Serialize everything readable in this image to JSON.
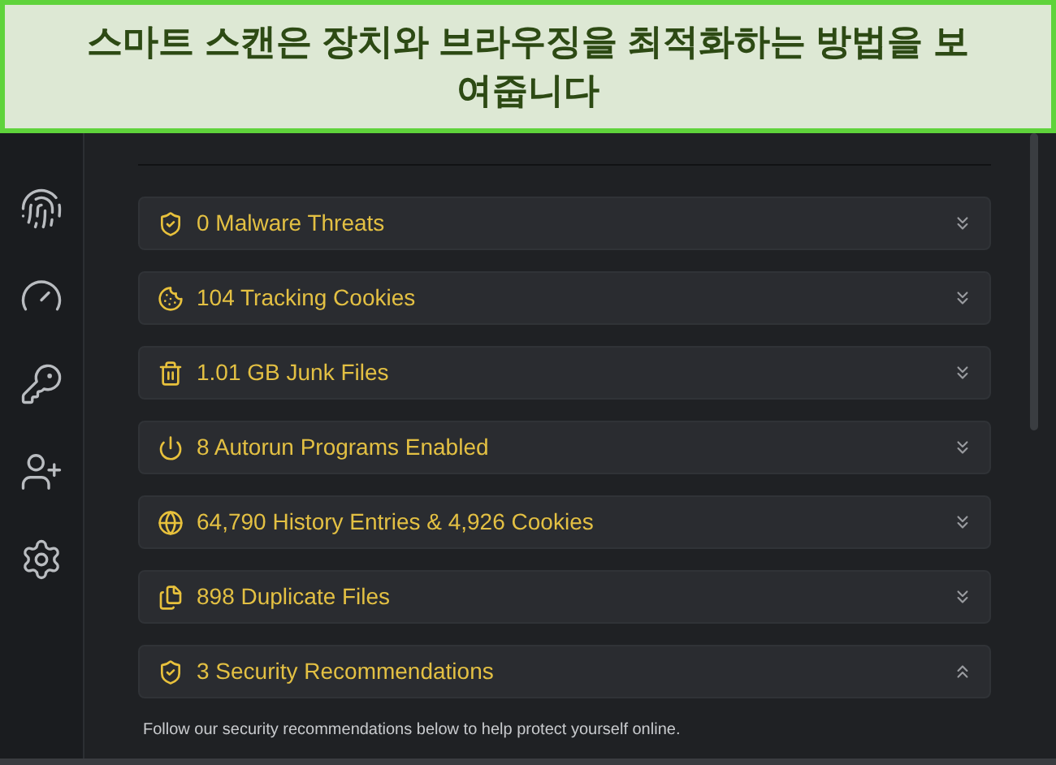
{
  "banner": {
    "title": "스마트 스캔은 장치와 브라우징을 최적화하는 방법을 보여줍니다"
  },
  "sidebar": {
    "items": [
      {
        "kind": "fingerprint"
      },
      {
        "kind": "gauge"
      },
      {
        "kind": "key"
      },
      {
        "kind": "user-plus"
      },
      {
        "kind": "settings"
      }
    ]
  },
  "results": [
    {
      "kind": "shield",
      "label": "0 Malware Threats",
      "expanded": false
    },
    {
      "kind": "cookie",
      "label": "104 Tracking Cookies",
      "expanded": false
    },
    {
      "kind": "trash",
      "label": "1.01 GB Junk Files",
      "expanded": false
    },
    {
      "kind": "power",
      "label": "8 Autorun Programs Enabled",
      "expanded": false
    },
    {
      "kind": "globe",
      "label": "64,790 History Entries & 4,926 Cookies",
      "expanded": false
    },
    {
      "kind": "files",
      "label": "898 Duplicate Files",
      "expanded": false
    },
    {
      "kind": "shield",
      "label": "3 Security Recommendations",
      "expanded": true
    }
  ],
  "recommendations_note": "Follow our security recommendations below to help protect yourself online."
}
